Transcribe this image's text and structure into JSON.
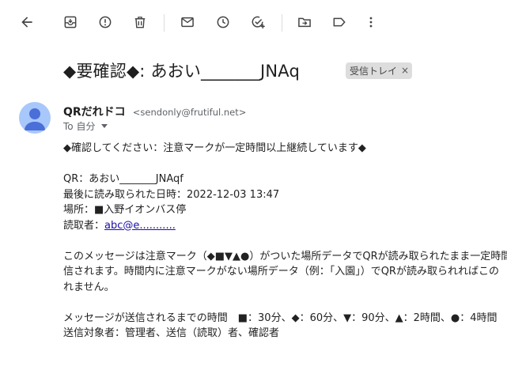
{
  "toolbar": {
    "back": "arrow-left-icon",
    "archive": "archive-icon",
    "spam": "report-spam-icon",
    "delete": "trash-icon",
    "unread": "mail-icon",
    "snooze": "clock-icon",
    "task": "add-task-icon",
    "move": "move-to-icon",
    "label": "label-icon",
    "more": "more-vert-icon"
  },
  "email": {
    "subject": "◆要確認◆: あおい_______JNAq",
    "label": "受信トレイ",
    "label_close": "×",
    "sender_name": "QRだれドコ",
    "sender_email": "<sendonly@frutiful.net>",
    "to": "To 自分",
    "body": {
      "line1": "◆確認してください：注意マークが一定時間以上継続しています◆",
      "qr": "QR：あおい_______JNAqf",
      "last_read": "最後に読み取られた日時：2022-12-03 13:47",
      "place": "場所：■入野イオンバス停",
      "reader_prefix": "読取者：",
      "reader_link": "abc@e...........",
      "para1": "このメッセージは注意マーク（◆■▼▲●）がついた場所データでQRが読み取られたまま一定時間",
      "para2": "信されます。時間内に注意マークがない場所データ（例：「入園」）でQRが読み取られればこの",
      "para3": "れません。",
      "times": "メッセージが送信されるまでの時間　■：30分、◆：60分、▼：90分、▲：2時間、●：4時間",
      "targets": "送信対象者：管理者、送信（読取）者、確認者"
    }
  },
  "colors": {
    "avatar_bg": "#a8c7fa",
    "avatar_fg": "#4a6fd8",
    "label_bg": "#dddddd",
    "link": "#1a0dab"
  }
}
